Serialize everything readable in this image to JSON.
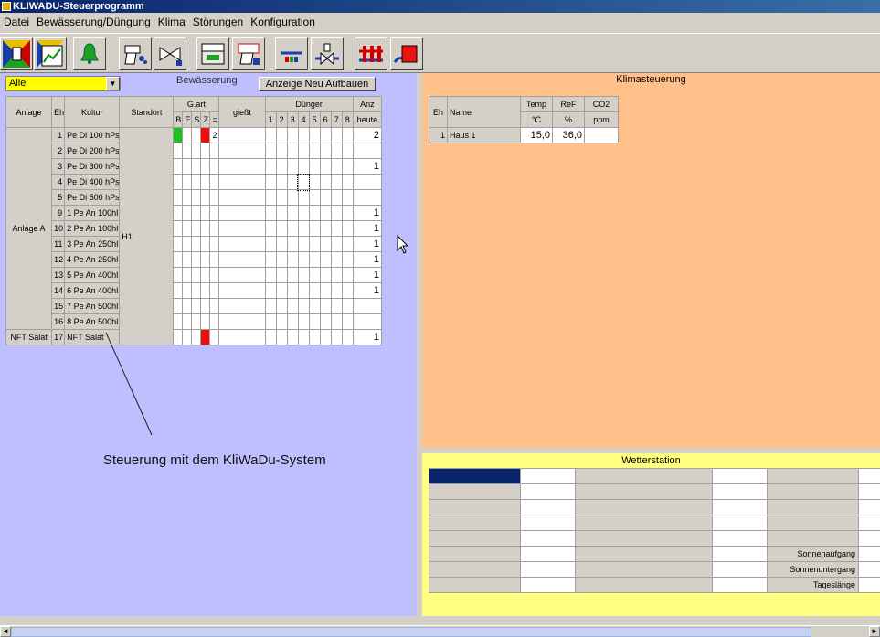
{
  "window": {
    "title": "KLIWADU-Steuerprogramm"
  },
  "menu": [
    "Datei",
    "Bewässerung/Düngung",
    "Klima",
    "Störungen",
    "Konfiguration"
  ],
  "toolbar": {
    "buttons": [
      "irrigation-start-icon",
      "irrigation-chart-icon",
      "alarm-bell-icon",
      "watering-hand-icon",
      "valve-icon",
      "greenhouse-control-icon",
      "climate-hand-icon",
      "scale-icon",
      "mixer-valve-icon",
      "heating-pipes-icon",
      "pump-icon"
    ]
  },
  "bewaesserung": {
    "filter_value": "Alle",
    "section_label": "Bewässerung",
    "rebuild_button": "Anzeige Neu Aufbauen",
    "headers": {
      "anlage": "Anlage",
      "eh": "Eh",
      "kultur": "Kultur",
      "standort": "Standort",
      "gart": "G.art",
      "giesst": "gießt",
      "duenger": "Dünger",
      "anz": "Anz",
      "heute": "heute"
    },
    "gart_cols": [
      "B",
      "E",
      "S",
      "Z",
      "="
    ],
    "duenger_cols": [
      "1",
      "2",
      "3",
      "4",
      "5",
      "6",
      "7",
      "8"
    ],
    "standort_value": "H1",
    "rows": [
      {
        "eh": "1",
        "kultur": "Pe Di 100 hPs",
        "g1": "green",
        "g4": "red",
        "gEq": "2",
        "anz": "2"
      },
      {
        "eh": "2",
        "kultur": "Pe Di 200 hPs",
        "anz": ""
      },
      {
        "eh": "3",
        "kultur": "Pe Di 300 hPs",
        "anz": "1"
      },
      {
        "eh": "4",
        "kultur": "Pe Di 400 hPs",
        "anz": ""
      },
      {
        "eh": "5",
        "kultur": "Pe Di 500 hPs",
        "anz": ""
      },
      {
        "eh": "9",
        "kultur": "1 Pe An 100hl",
        "anz": "1"
      },
      {
        "eh": "10",
        "kultur": "2 Pe An 100hl",
        "anz": "1"
      },
      {
        "eh": "11",
        "kultur": "3 Pe An 250hl",
        "anz": "1"
      },
      {
        "eh": "12",
        "kultur": "4 Pe An 250hl",
        "anz": "1"
      },
      {
        "eh": "13",
        "kultur": "5 Pe An 400hl",
        "anz": "1"
      },
      {
        "eh": "14",
        "kultur": "6 Pe An 400hl",
        "anz": "1"
      },
      {
        "eh": "15",
        "kultur": "7 Pe An 500hl",
        "anz": ""
      },
      {
        "eh": "16",
        "kultur": "8 Pe An 500hl",
        "anz": ""
      }
    ],
    "group_anlage": "Anlage A",
    "nft_row": {
      "anlage": "NFT Salat",
      "eh": "17",
      "kultur": "NFT Salat",
      "anz": "1"
    },
    "annotation": "Steuerung mit dem KliWaDu-System"
  },
  "klima": {
    "title": "Klimasteuerung",
    "headers": {
      "eh": "Eh",
      "name": "Name",
      "temp": "Temp",
      "ref": "ReF",
      "co2": "CO2",
      "temp_unit": "°C",
      "ref_unit": "%",
      "co2_unit": "ppm"
    },
    "row": {
      "eh": "1",
      "name": "Haus 1",
      "temp": "15,0",
      "ref": "36,0",
      "co2": ""
    }
  },
  "wetter": {
    "title": "Wetterstation",
    "labels": [
      "",
      "",
      "",
      "",
      "",
      "Sonnenaufgang",
      "Sonnenuntergang",
      "Tageslänge"
    ]
  },
  "colors": {
    "left_panel": "#bfbfff",
    "klima_panel": "#ffc08a",
    "wetter_panel": "#ffff80",
    "filter_bg": "#ffff00"
  }
}
